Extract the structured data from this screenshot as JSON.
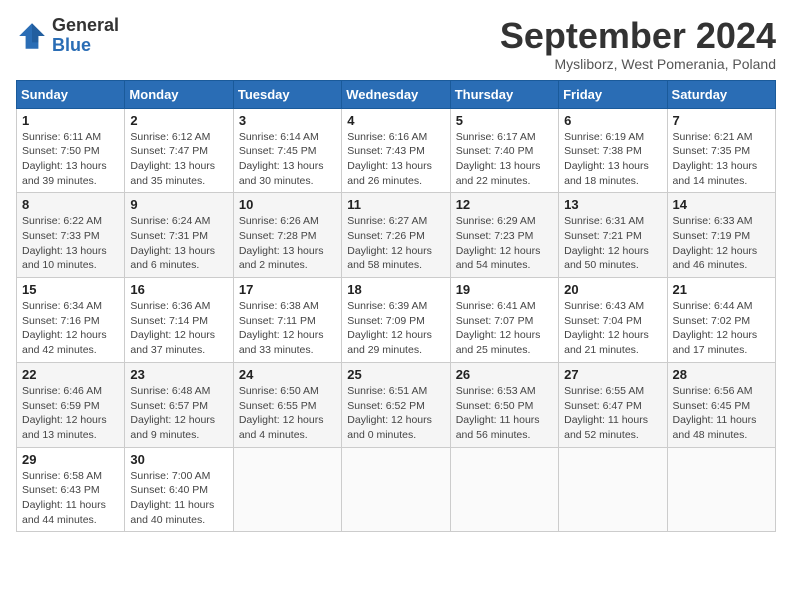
{
  "header": {
    "logo_general": "General",
    "logo_blue": "Blue",
    "month_title": "September 2024",
    "subtitle": "Mysliborz, West Pomerania, Poland"
  },
  "weekdays": [
    "Sunday",
    "Monday",
    "Tuesday",
    "Wednesday",
    "Thursday",
    "Friday",
    "Saturday"
  ],
  "weeks": [
    [
      {
        "day": "1",
        "info": "Sunrise: 6:11 AM\nSunset: 7:50 PM\nDaylight: 13 hours\nand 39 minutes."
      },
      {
        "day": "2",
        "info": "Sunrise: 6:12 AM\nSunset: 7:47 PM\nDaylight: 13 hours\nand 35 minutes."
      },
      {
        "day": "3",
        "info": "Sunrise: 6:14 AM\nSunset: 7:45 PM\nDaylight: 13 hours\nand 30 minutes."
      },
      {
        "day": "4",
        "info": "Sunrise: 6:16 AM\nSunset: 7:43 PM\nDaylight: 13 hours\nand 26 minutes."
      },
      {
        "day": "5",
        "info": "Sunrise: 6:17 AM\nSunset: 7:40 PM\nDaylight: 13 hours\nand 22 minutes."
      },
      {
        "day": "6",
        "info": "Sunrise: 6:19 AM\nSunset: 7:38 PM\nDaylight: 13 hours\nand 18 minutes."
      },
      {
        "day": "7",
        "info": "Sunrise: 6:21 AM\nSunset: 7:35 PM\nDaylight: 13 hours\nand 14 minutes."
      }
    ],
    [
      {
        "day": "8",
        "info": "Sunrise: 6:22 AM\nSunset: 7:33 PM\nDaylight: 13 hours\nand 10 minutes."
      },
      {
        "day": "9",
        "info": "Sunrise: 6:24 AM\nSunset: 7:31 PM\nDaylight: 13 hours\nand 6 minutes."
      },
      {
        "day": "10",
        "info": "Sunrise: 6:26 AM\nSunset: 7:28 PM\nDaylight: 13 hours\nand 2 minutes."
      },
      {
        "day": "11",
        "info": "Sunrise: 6:27 AM\nSunset: 7:26 PM\nDaylight: 12 hours\nand 58 minutes."
      },
      {
        "day": "12",
        "info": "Sunrise: 6:29 AM\nSunset: 7:23 PM\nDaylight: 12 hours\nand 54 minutes."
      },
      {
        "day": "13",
        "info": "Sunrise: 6:31 AM\nSunset: 7:21 PM\nDaylight: 12 hours\nand 50 minutes."
      },
      {
        "day": "14",
        "info": "Sunrise: 6:33 AM\nSunset: 7:19 PM\nDaylight: 12 hours\nand 46 minutes."
      }
    ],
    [
      {
        "day": "15",
        "info": "Sunrise: 6:34 AM\nSunset: 7:16 PM\nDaylight: 12 hours\nand 42 minutes."
      },
      {
        "day": "16",
        "info": "Sunrise: 6:36 AM\nSunset: 7:14 PM\nDaylight: 12 hours\nand 37 minutes."
      },
      {
        "day": "17",
        "info": "Sunrise: 6:38 AM\nSunset: 7:11 PM\nDaylight: 12 hours\nand 33 minutes."
      },
      {
        "day": "18",
        "info": "Sunrise: 6:39 AM\nSunset: 7:09 PM\nDaylight: 12 hours\nand 29 minutes."
      },
      {
        "day": "19",
        "info": "Sunrise: 6:41 AM\nSunset: 7:07 PM\nDaylight: 12 hours\nand 25 minutes."
      },
      {
        "day": "20",
        "info": "Sunrise: 6:43 AM\nSunset: 7:04 PM\nDaylight: 12 hours\nand 21 minutes."
      },
      {
        "day": "21",
        "info": "Sunrise: 6:44 AM\nSunset: 7:02 PM\nDaylight: 12 hours\nand 17 minutes."
      }
    ],
    [
      {
        "day": "22",
        "info": "Sunrise: 6:46 AM\nSunset: 6:59 PM\nDaylight: 12 hours\nand 13 minutes."
      },
      {
        "day": "23",
        "info": "Sunrise: 6:48 AM\nSunset: 6:57 PM\nDaylight: 12 hours\nand 9 minutes."
      },
      {
        "day": "24",
        "info": "Sunrise: 6:50 AM\nSunset: 6:55 PM\nDaylight: 12 hours\nand 4 minutes."
      },
      {
        "day": "25",
        "info": "Sunrise: 6:51 AM\nSunset: 6:52 PM\nDaylight: 12 hours\nand 0 minutes."
      },
      {
        "day": "26",
        "info": "Sunrise: 6:53 AM\nSunset: 6:50 PM\nDaylight: 11 hours\nand 56 minutes."
      },
      {
        "day": "27",
        "info": "Sunrise: 6:55 AM\nSunset: 6:47 PM\nDaylight: 11 hours\nand 52 minutes."
      },
      {
        "day": "28",
        "info": "Sunrise: 6:56 AM\nSunset: 6:45 PM\nDaylight: 11 hours\nand 48 minutes."
      }
    ],
    [
      {
        "day": "29",
        "info": "Sunrise: 6:58 AM\nSunset: 6:43 PM\nDaylight: 11 hours\nand 44 minutes."
      },
      {
        "day": "30",
        "info": "Sunrise: 7:00 AM\nSunset: 6:40 PM\nDaylight: 11 hours\nand 40 minutes."
      },
      null,
      null,
      null,
      null,
      null
    ]
  ]
}
